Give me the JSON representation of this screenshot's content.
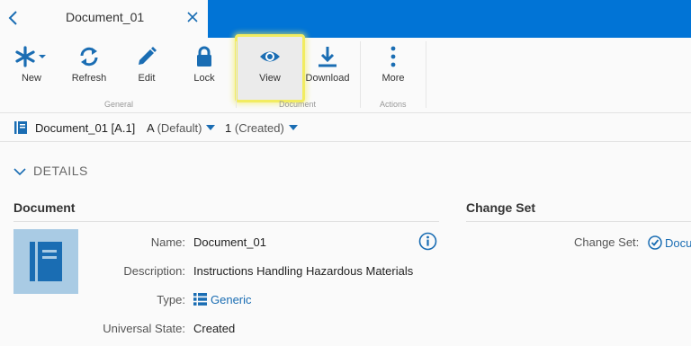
{
  "tab": {
    "title": "Document_01"
  },
  "ribbon": {
    "buttons": {
      "new": "New",
      "refresh": "Refresh",
      "edit": "Edit",
      "lock": "Lock",
      "view": "View",
      "download": "Download",
      "more": "More"
    },
    "groups": {
      "general": "General",
      "document": "Document",
      "actions": "Actions"
    }
  },
  "version_bar": {
    "name": "Document_01 [A.1]",
    "revision_letter": "A",
    "revision_label": "(Default)",
    "iteration_number": "1",
    "iteration_label": "(Created)"
  },
  "details": {
    "header": "DETAILS",
    "document_section": {
      "title": "Document",
      "fields": [
        {
          "label": "Name:",
          "value": "Document_01"
        },
        {
          "label": "Description:",
          "value": "Instructions Handling Hazardous Materials"
        },
        {
          "label": "Type:",
          "value": "Generic"
        },
        {
          "label": "Universal State:",
          "value": "Created"
        }
      ]
    },
    "change_set_section": {
      "title": "Change Set",
      "label": "Change Set:",
      "value": "Docu"
    }
  },
  "colors": {
    "accent": "#0174d6",
    "link": "#1a6db3",
    "highlight": "#f2ec61"
  },
  "icons": [
    "back-arrow-icon",
    "close-icon",
    "new-asterisk-icon",
    "refresh-icon",
    "pencil-icon",
    "lock-icon",
    "eye-icon",
    "download-icon",
    "more-vertical-icon",
    "document-icon",
    "chevron-down-icon",
    "info-icon",
    "list-icon",
    "check-circle-icon"
  ]
}
